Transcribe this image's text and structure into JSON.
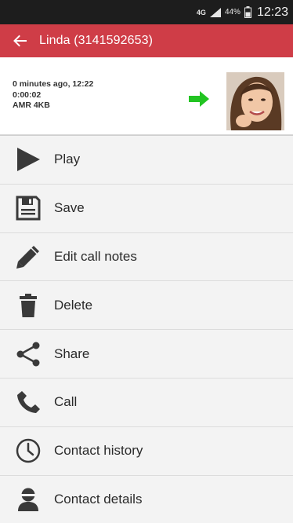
{
  "status_bar": {
    "network": "4G",
    "battery": "44%",
    "time": "12:23"
  },
  "app_bar": {
    "title": "Linda (3141592653)"
  },
  "call_info": {
    "time_ago": "0 minutes ago, 12:22",
    "duration": "0:00:02",
    "format": "AMR 4KB"
  },
  "colors": {
    "app_bar": "#cf3d47",
    "arrow": "#22c422",
    "icon": "#3a3a3a"
  },
  "menu": {
    "items": [
      {
        "label": "Play",
        "icon": "play-icon"
      },
      {
        "label": "Save",
        "icon": "save-icon"
      },
      {
        "label": "Edit call notes",
        "icon": "pencil-icon"
      },
      {
        "label": "Delete",
        "icon": "trash-icon"
      },
      {
        "label": "Share",
        "icon": "share-icon"
      },
      {
        "label": "Call",
        "icon": "phone-icon"
      },
      {
        "label": "Contact history",
        "icon": "clock-icon"
      },
      {
        "label": "Contact details",
        "icon": "person-icon"
      }
    ]
  }
}
